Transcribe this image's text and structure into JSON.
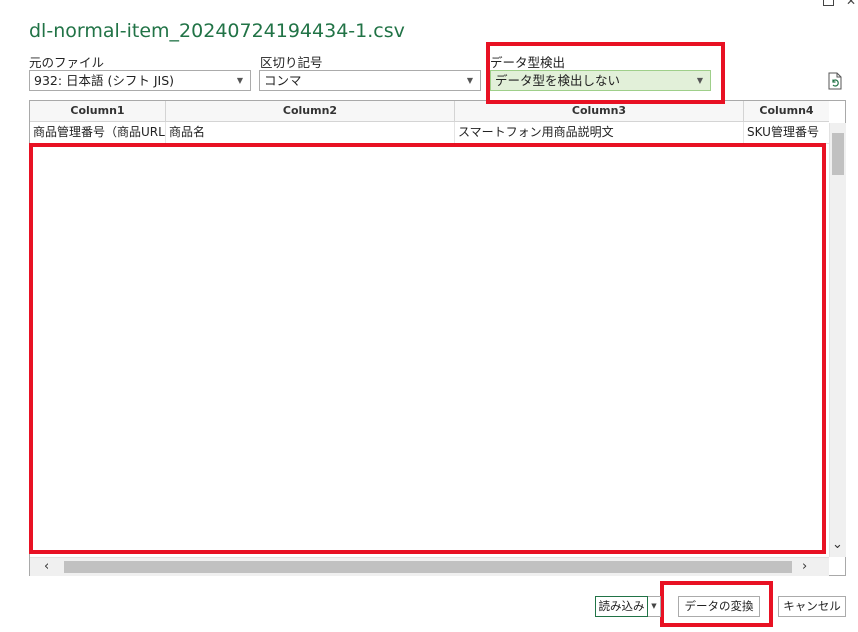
{
  "dialog": {
    "title": "dl-normal-item_20240724194434-1.csv"
  },
  "options": {
    "file_origin_label": "元のファイル",
    "file_origin_value": "932: 日本語 (シフト JIS)",
    "delimiter_label": "区切り記号",
    "delimiter_value": "コンマ",
    "type_detect_label": "データ型検出",
    "type_detect_value": "データ型を検出しない"
  },
  "preview": {
    "headers": [
      "Column1",
      "Column2",
      "Column3",
      "Column4"
    ],
    "row1": [
      "商品管理番号（商品URL）",
      "商品名",
      "スマートフォン用商品説明文",
      "SKU管理番号"
    ]
  },
  "footer": {
    "load_label": "読み込み",
    "transform_label": "データの変換",
    "cancel_label": "キャンセル"
  },
  "icons": {
    "refresh": "refresh-icon",
    "caret": "chevron-down-icon",
    "scroll_up": "chevron-up-icon",
    "scroll_down": "chevron-down-icon",
    "scroll_left": "chevron-left-icon",
    "scroll_right": "chevron-right-icon"
  },
  "colors": {
    "title": "#217346",
    "highlight": "#e81123",
    "detect_bg": "#e2f0d9"
  }
}
